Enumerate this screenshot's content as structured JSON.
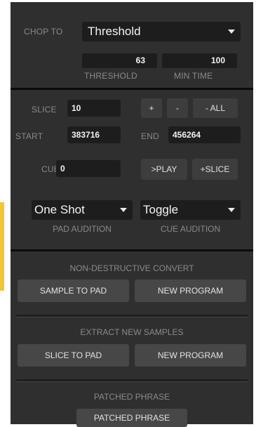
{
  "chop": {
    "label": "CHOP TO",
    "mode": "Threshold",
    "threshold_value": "63",
    "threshold_label": "THRESHOLD",
    "min_time_value": "100",
    "min_time_label": "MIN TIME"
  },
  "slice": {
    "slice_label": "SLICE",
    "slice_value": "10",
    "plus": "+",
    "minus": "-",
    "minus_all": "- ALL",
    "start_label": "START",
    "start_value": "383716",
    "end_label": "END",
    "end_value": "456264",
    "cue_label": "CUE",
    "cue_value": "0",
    "play": ">PLAY",
    "add_slice": "+SLICE"
  },
  "audition": {
    "pad_mode": "One Shot",
    "pad_label": "PAD AUDITION",
    "cue_mode": "Toggle",
    "cue_label": "CUE AUDITION"
  },
  "convert": {
    "title": "NON-DESTRUCTIVE CONVERT",
    "sample_to_pad": "SAMPLE TO PAD",
    "new_program": "NEW PROGRAM"
  },
  "extract": {
    "title": "EXTRACT NEW SAMPLES",
    "slice_to_pad": "SLICE TO PAD",
    "new_program": "NEW PROGRAM"
  },
  "phrase": {
    "title": "PATCHED PHRASE",
    "button": "PATCHED PHRASE"
  },
  "colors": {
    "panel": "#2f2f2f",
    "field": "#1d1d1d",
    "accent": "#f4c437"
  }
}
